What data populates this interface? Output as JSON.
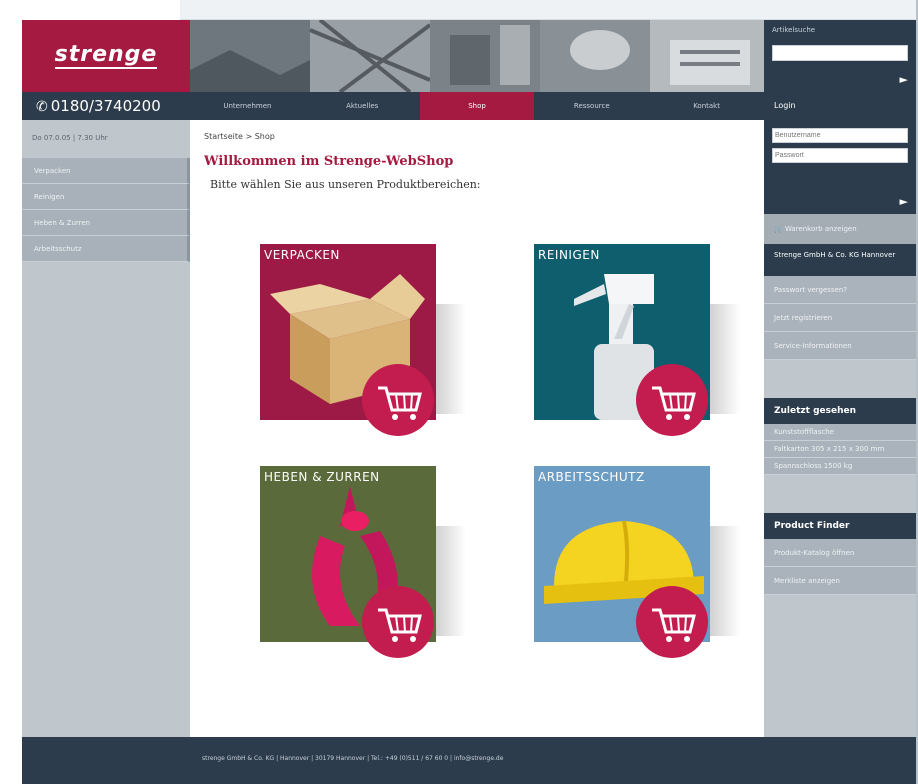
{
  "header": {
    "logo_text": "strenge",
    "phone": "0180/3740200",
    "search_label": "Artikelsuche",
    "search_value": "",
    "search_go": "►"
  },
  "nav": {
    "tabs": [
      {
        "label": "Unternehmen"
      },
      {
        "label": "Aktuelles"
      },
      {
        "label": "Shop"
      },
      {
        "label": "Ressource"
      },
      {
        "label": "Kontakt"
      }
    ]
  },
  "left": {
    "date": "Do 07.0.05 | 7.30 Uhr",
    "items": [
      {
        "label": "Verpacken"
      },
      {
        "label": "Reinigen"
      },
      {
        "label": "Heben & Zurren"
      },
      {
        "label": "Arbeitsschutz"
      }
    ]
  },
  "main": {
    "breadcrumb": "Startseite > Shop",
    "welcome": "Willkommen im Strenge-WebShop",
    "choose": "Bitte wählen Sie aus unseren Produktbereichen:",
    "categories": [
      {
        "label": "VERPACKEN",
        "color": "#9c1a45"
      },
      {
        "label": "REINIGEN",
        "color": "#0f5e6e"
      },
      {
        "label": "HEBEN & ZURREN",
        "color": "#5a6a3a"
      },
      {
        "label": "ARBEITSSCHUTZ",
        "color": "#6a9cc4"
      }
    ]
  },
  "right": {
    "login_title": "Login",
    "user_placeholder": "Benutzername",
    "pass_placeholder": "Passwort",
    "login_go": "►",
    "basket": "Warenkorb anzeigen",
    "company": "Strenge GmbH & Co. KG Hannover",
    "links": [
      {
        "label": "Passwort vergessen?"
      },
      {
        "label": "Jetzt registrieren"
      },
      {
        "label": "Service-Informationen"
      }
    ],
    "seen_title": "Zuletzt gesehen",
    "seen_items": [
      {
        "label": "Kunststoffflasche"
      },
      {
        "label": "Faltkarton 305 x 215 x 300 mm"
      },
      {
        "label": "Spannschloss 1500 kg"
      }
    ],
    "finder_title": "Product Finder",
    "finder_links": [
      {
        "label": "Produkt-Katalog öffnen"
      },
      {
        "label": "Merkliste anzeigen"
      }
    ]
  },
  "footer": {
    "text": "strenge GmbH & Co. KG | Hannover | 30179 Hannover | Tel.: +49 (0)511 / 67 60 0 | info@strenge.de"
  }
}
